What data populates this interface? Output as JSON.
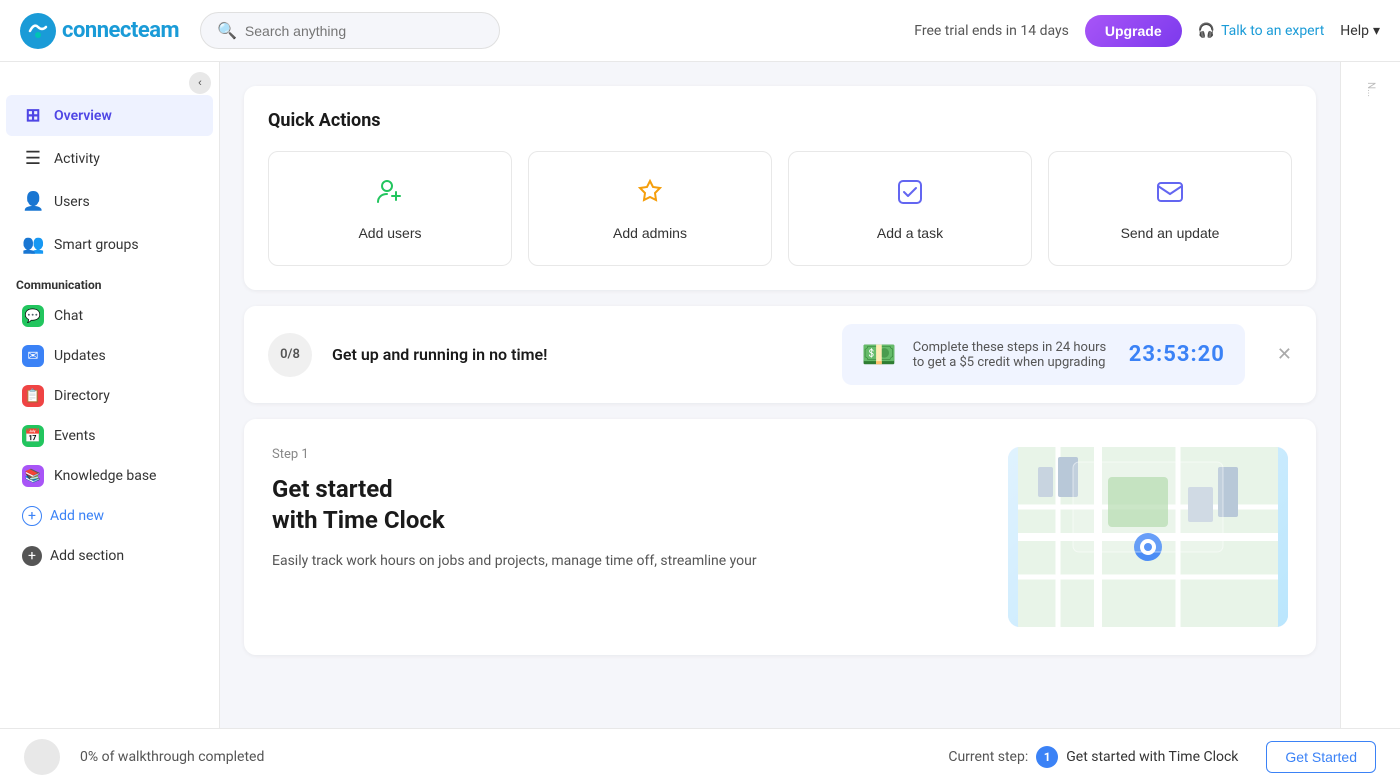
{
  "header": {
    "logo_text": "connecteam",
    "search_placeholder": "Search anything",
    "trial_text": "Free trial ends in 14 days",
    "upgrade_label": "Upgrade",
    "talk_expert_label": "Talk to an expert",
    "help_label": "Help"
  },
  "sidebar": {
    "collapse_icon": "‹",
    "overview_label": "Overview",
    "activity_label": "Activity",
    "users_label": "Users",
    "smart_groups_label": "Smart groups",
    "communication_label": "Communication",
    "items": [
      {
        "label": "Chat",
        "icon": "💬",
        "color": "icon-chat"
      },
      {
        "label": "Updates",
        "icon": "✉",
        "color": "icon-updates"
      },
      {
        "label": "Directory",
        "icon": "📋",
        "color": "icon-directory"
      },
      {
        "label": "Events",
        "icon": "📅",
        "color": "icon-events"
      },
      {
        "label": "Knowledge base",
        "icon": "📚",
        "color": "icon-knowledge"
      }
    ],
    "add_new_label": "Add new",
    "add_section_label": "Add section"
  },
  "quick_actions": {
    "title": "Quick Actions",
    "buttons": [
      {
        "label": "Add users",
        "icon": "👤"
      },
      {
        "label": "Add admins",
        "icon": "👑"
      },
      {
        "label": "Add a task",
        "icon": "✅"
      },
      {
        "label": "Send an update",
        "icon": "📧"
      }
    ]
  },
  "progress_banner": {
    "badge": "0/8",
    "text": "Get up and running in no time!",
    "credit_desc": "Complete these steps in 24 hours to get a $5 credit when upgrading",
    "timer": "23:53:20"
  },
  "step_card": {
    "step_label": "Step 1",
    "title": "Get started\nwith Time Clock",
    "description": "Easily track work hours on jobs and projects, manage time off, streamline your"
  },
  "bottom_bar": {
    "progress_pct": "0% of walkthrough completed",
    "current_step_label": "Current step:",
    "step_number": "1",
    "step_name": "Get started with Time Clock",
    "get_started_label": "Get Started"
  }
}
